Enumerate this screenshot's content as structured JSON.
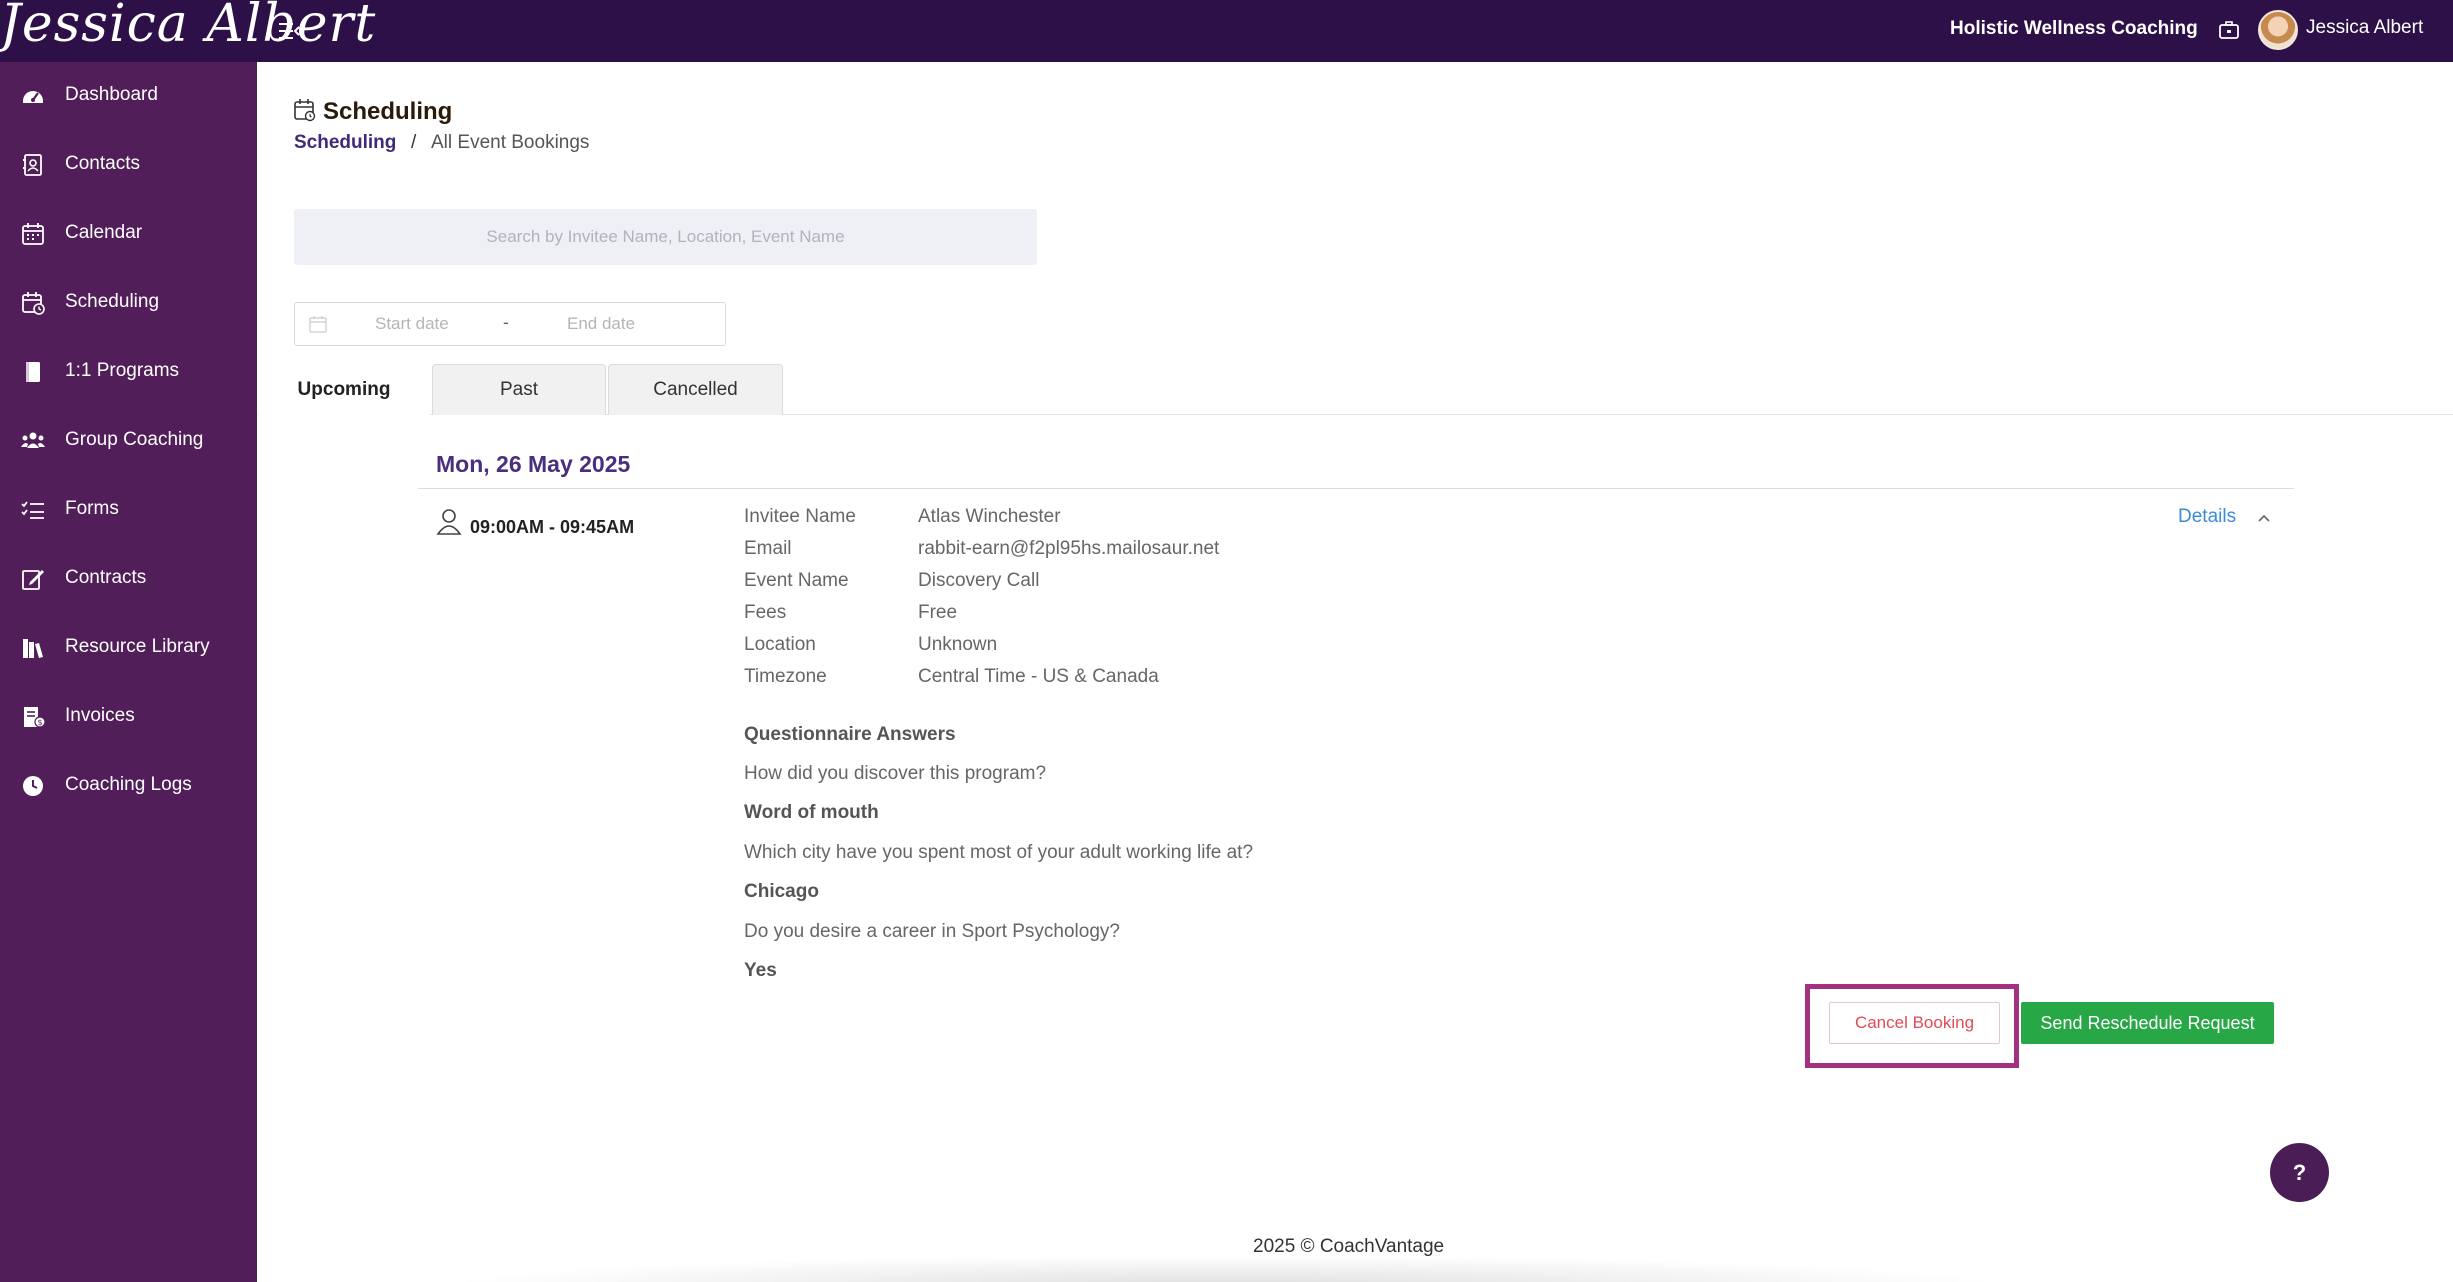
{
  "topbar": {
    "logo_text": "Jessica Albert",
    "org_name": "Holistic Wellness Coaching",
    "user_name": "Jessica Albert"
  },
  "sidebar": {
    "items": [
      {
        "label": "Dashboard",
        "icon": "dashboard-gauge-icon"
      },
      {
        "label": "Contacts",
        "icon": "contacts-book-icon"
      },
      {
        "label": "Calendar",
        "icon": "calendar-icon"
      },
      {
        "label": "Scheduling",
        "icon": "scheduling-calendar-icon"
      },
      {
        "label": "1:1 Programs",
        "icon": "book-icon"
      },
      {
        "label": "Group Coaching",
        "icon": "group-users-icon"
      },
      {
        "label": "Forms",
        "icon": "checklist-icon"
      },
      {
        "label": "Contracts",
        "icon": "signature-icon"
      },
      {
        "label": "Resource Library",
        "icon": "library-books-icon"
      },
      {
        "label": "Invoices",
        "icon": "invoice-icon"
      },
      {
        "label": "Coaching Logs",
        "icon": "clock-icon"
      }
    ]
  },
  "page": {
    "title": "Scheduling",
    "breadcrumb_link": "Scheduling",
    "breadcrumb_sep": "/",
    "breadcrumb_current": "All Event Bookings"
  },
  "search": {
    "placeholder": "Search by Invitee Name, Location, Event Name"
  },
  "date_range": {
    "start_placeholder": "Start date",
    "separator": "-",
    "end_placeholder": "End date"
  },
  "tabs": [
    "Upcoming",
    "Past",
    "Cancelled"
  ],
  "booking": {
    "date_header": "Mon, 26 May 2025",
    "time": "09:00AM - 09:45AM",
    "details_toggle": "Details",
    "fields": [
      {
        "label": "Invitee Name",
        "value": "Atlas Winchester"
      },
      {
        "label": "Email",
        "value": "rabbit-earn@f2pl95hs.mailosaur.net"
      },
      {
        "label": "Event Name",
        "value": "Discovery Call"
      },
      {
        "label": "Fees",
        "value": "Free"
      },
      {
        "label": "Location",
        "value": "Unknown"
      },
      {
        "label": "Timezone",
        "value": "Central Time - US & Canada"
      }
    ],
    "questionnaire_title": "Questionnaire Answers",
    "qa": [
      {
        "q": "How did you discover this program?",
        "a": "Word of mouth"
      },
      {
        "q": "Which city have you spent most of your adult working life at?",
        "a": "Chicago"
      },
      {
        "q": "Do you desire a career in Sport Psychology?",
        "a": "Yes"
      }
    ],
    "cancel_label": "Cancel Booking",
    "reschedule_label": "Send Reschedule Request"
  },
  "help_label": "?",
  "footer": "2025 © CoachVantage",
  "colors": {
    "topbar": "#2e1048",
    "sidebar": "#511e59",
    "highlight": "#a3317f",
    "reschedule": "#27a745",
    "cancel_text": "#e24b55",
    "link": "#3a8cd9"
  }
}
